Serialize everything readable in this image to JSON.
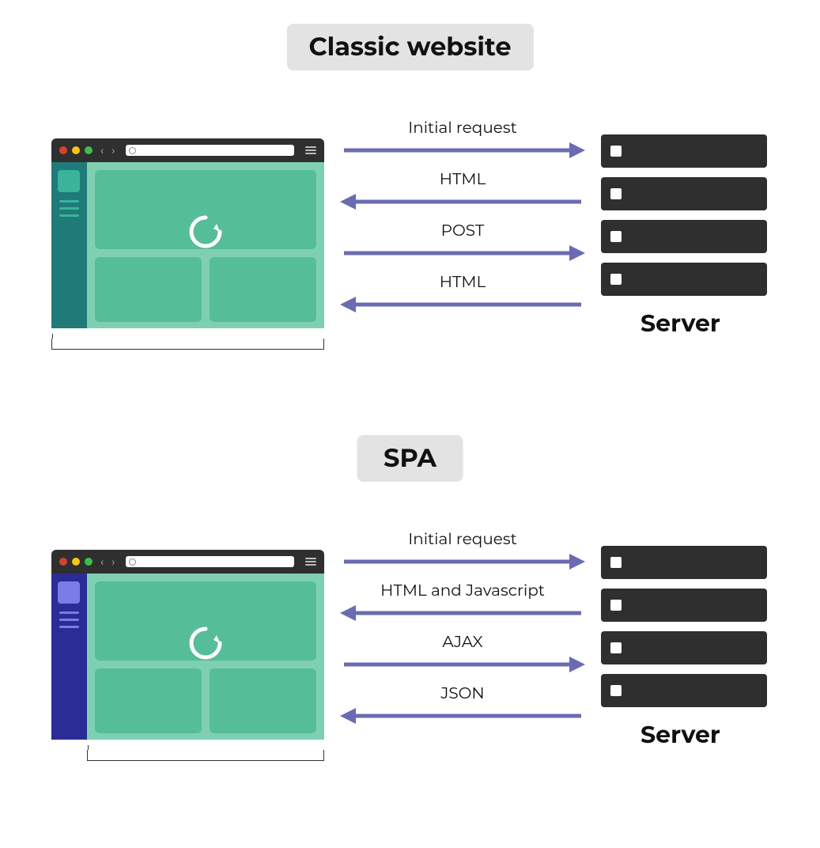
{
  "sections": {
    "classic": {
      "title": "Classic website",
      "server_label": "Server",
      "arrows": [
        {
          "label": "Initial request",
          "dir": "right"
        },
        {
          "label": "HTML",
          "dir": "left"
        },
        {
          "label": "POST",
          "dir": "right"
        },
        {
          "label": "HTML",
          "dir": "left"
        }
      ]
    },
    "spa": {
      "title": "SPA",
      "server_label": "Server",
      "arrows": [
        {
          "label": "Initial request",
          "dir": "right"
        },
        {
          "label": "HTML and Javascript",
          "dir": "left"
        },
        {
          "label": "AJAX",
          "dir": "right"
        },
        {
          "label": "JSON",
          "dir": "left"
        }
      ]
    }
  },
  "colors": {
    "arrow": "#6b6bb3",
    "traffic_red": "#d8412f",
    "traffic_yellow": "#f5c518",
    "traffic_green": "#3cbf4b"
  }
}
